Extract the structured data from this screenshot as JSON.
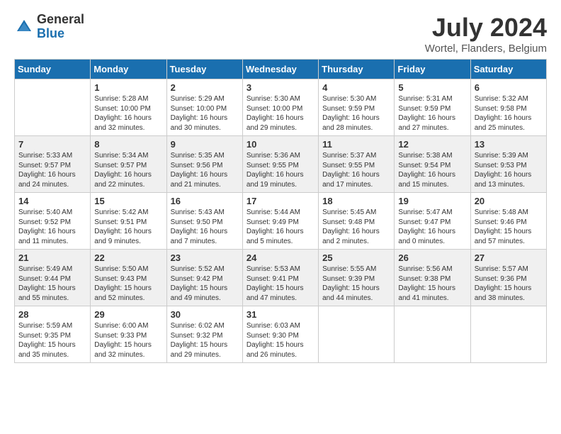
{
  "logo": {
    "general": "General",
    "blue": "Blue"
  },
  "title": {
    "month_year": "July 2024",
    "location": "Wortel, Flanders, Belgium"
  },
  "days_of_week": [
    "Sunday",
    "Monday",
    "Tuesday",
    "Wednesday",
    "Thursday",
    "Friday",
    "Saturday"
  ],
  "weeks": [
    [
      {
        "day": "",
        "info": ""
      },
      {
        "day": "1",
        "info": "Sunrise: 5:28 AM\nSunset: 10:00 PM\nDaylight: 16 hours\nand 32 minutes."
      },
      {
        "day": "2",
        "info": "Sunrise: 5:29 AM\nSunset: 10:00 PM\nDaylight: 16 hours\nand 30 minutes."
      },
      {
        "day": "3",
        "info": "Sunrise: 5:30 AM\nSunset: 10:00 PM\nDaylight: 16 hours\nand 29 minutes."
      },
      {
        "day": "4",
        "info": "Sunrise: 5:30 AM\nSunset: 9:59 PM\nDaylight: 16 hours\nand 28 minutes."
      },
      {
        "day": "5",
        "info": "Sunrise: 5:31 AM\nSunset: 9:59 PM\nDaylight: 16 hours\nand 27 minutes."
      },
      {
        "day": "6",
        "info": "Sunrise: 5:32 AM\nSunset: 9:58 PM\nDaylight: 16 hours\nand 25 minutes."
      }
    ],
    [
      {
        "day": "7",
        "info": "Sunrise: 5:33 AM\nSunset: 9:57 PM\nDaylight: 16 hours\nand 24 minutes."
      },
      {
        "day": "8",
        "info": "Sunrise: 5:34 AM\nSunset: 9:57 PM\nDaylight: 16 hours\nand 22 minutes."
      },
      {
        "day": "9",
        "info": "Sunrise: 5:35 AM\nSunset: 9:56 PM\nDaylight: 16 hours\nand 21 minutes."
      },
      {
        "day": "10",
        "info": "Sunrise: 5:36 AM\nSunset: 9:55 PM\nDaylight: 16 hours\nand 19 minutes."
      },
      {
        "day": "11",
        "info": "Sunrise: 5:37 AM\nSunset: 9:55 PM\nDaylight: 16 hours\nand 17 minutes."
      },
      {
        "day": "12",
        "info": "Sunrise: 5:38 AM\nSunset: 9:54 PM\nDaylight: 16 hours\nand 15 minutes."
      },
      {
        "day": "13",
        "info": "Sunrise: 5:39 AM\nSunset: 9:53 PM\nDaylight: 16 hours\nand 13 minutes."
      }
    ],
    [
      {
        "day": "14",
        "info": "Sunrise: 5:40 AM\nSunset: 9:52 PM\nDaylight: 16 hours\nand 11 minutes."
      },
      {
        "day": "15",
        "info": "Sunrise: 5:42 AM\nSunset: 9:51 PM\nDaylight: 16 hours\nand 9 minutes."
      },
      {
        "day": "16",
        "info": "Sunrise: 5:43 AM\nSunset: 9:50 PM\nDaylight: 16 hours\nand 7 minutes."
      },
      {
        "day": "17",
        "info": "Sunrise: 5:44 AM\nSunset: 9:49 PM\nDaylight: 16 hours\nand 5 minutes."
      },
      {
        "day": "18",
        "info": "Sunrise: 5:45 AM\nSunset: 9:48 PM\nDaylight: 16 hours\nand 2 minutes."
      },
      {
        "day": "19",
        "info": "Sunrise: 5:47 AM\nSunset: 9:47 PM\nDaylight: 16 hours\nand 0 minutes."
      },
      {
        "day": "20",
        "info": "Sunrise: 5:48 AM\nSunset: 9:46 PM\nDaylight: 15 hours\nand 57 minutes."
      }
    ],
    [
      {
        "day": "21",
        "info": "Sunrise: 5:49 AM\nSunset: 9:44 PM\nDaylight: 15 hours\nand 55 minutes."
      },
      {
        "day": "22",
        "info": "Sunrise: 5:50 AM\nSunset: 9:43 PM\nDaylight: 15 hours\nand 52 minutes."
      },
      {
        "day": "23",
        "info": "Sunrise: 5:52 AM\nSunset: 9:42 PM\nDaylight: 15 hours\nand 49 minutes."
      },
      {
        "day": "24",
        "info": "Sunrise: 5:53 AM\nSunset: 9:41 PM\nDaylight: 15 hours\nand 47 minutes."
      },
      {
        "day": "25",
        "info": "Sunrise: 5:55 AM\nSunset: 9:39 PM\nDaylight: 15 hours\nand 44 minutes."
      },
      {
        "day": "26",
        "info": "Sunrise: 5:56 AM\nSunset: 9:38 PM\nDaylight: 15 hours\nand 41 minutes."
      },
      {
        "day": "27",
        "info": "Sunrise: 5:57 AM\nSunset: 9:36 PM\nDaylight: 15 hours\nand 38 minutes."
      }
    ],
    [
      {
        "day": "28",
        "info": "Sunrise: 5:59 AM\nSunset: 9:35 PM\nDaylight: 15 hours\nand 35 minutes."
      },
      {
        "day": "29",
        "info": "Sunrise: 6:00 AM\nSunset: 9:33 PM\nDaylight: 15 hours\nand 32 minutes."
      },
      {
        "day": "30",
        "info": "Sunrise: 6:02 AM\nSunset: 9:32 PM\nDaylight: 15 hours\nand 29 minutes."
      },
      {
        "day": "31",
        "info": "Sunrise: 6:03 AM\nSunset: 9:30 PM\nDaylight: 15 hours\nand 26 minutes."
      },
      {
        "day": "",
        "info": ""
      },
      {
        "day": "",
        "info": ""
      },
      {
        "day": "",
        "info": ""
      }
    ]
  ]
}
